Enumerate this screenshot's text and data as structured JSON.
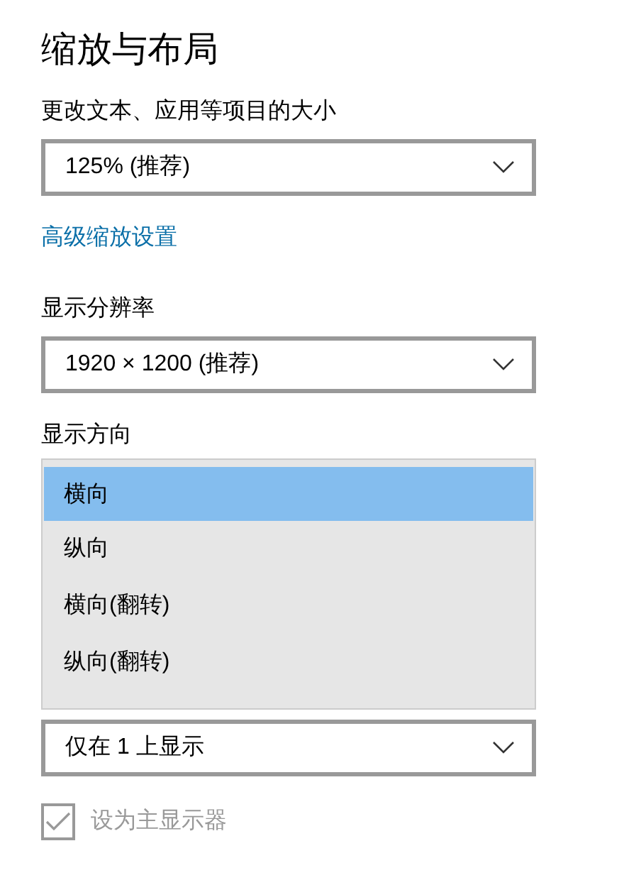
{
  "title": "缩放与布局",
  "scale": {
    "label": "更改文本、应用等项目的大小",
    "value": "125% (推荐)"
  },
  "advanced_link": "高级缩放设置",
  "resolution": {
    "label": "显示分辨率",
    "value": "1920 × 1200 (推荐)"
  },
  "orientation": {
    "label": "显示方向",
    "expanded": true,
    "options": [
      {
        "label": "横向",
        "selected": true
      },
      {
        "label": "纵向",
        "selected": false
      },
      {
        "label": "横向(翻转)",
        "selected": false
      },
      {
        "label": "纵向(翻转)",
        "selected": false
      }
    ]
  },
  "multiple_displays": {
    "value": "仅在 1 上显示"
  },
  "main_display": {
    "label": "设为主显示器",
    "checked": true,
    "disabled": true
  }
}
